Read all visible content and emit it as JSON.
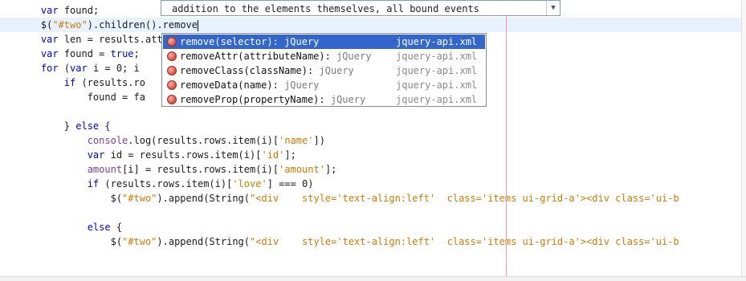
{
  "editor": {
    "lines": [
      {
        "segments": [
          {
            "t": "    "
          },
          {
            "t": "var",
            "k": "kw"
          },
          {
            "t": " found;"
          }
        ]
      },
      {
        "current": true,
        "segments": [
          {
            "t": "    $("
          },
          {
            "t": "\"#two\"",
            "k": "str"
          },
          {
            "t": ").children().remove"
          }
        ]
      },
      {
        "segments": [
          {
            "t": "    "
          },
          {
            "t": "var",
            "k": "kw"
          },
          {
            "t": " len = results.attr"
          }
        ]
      },
      {
        "segments": [
          {
            "t": "    "
          },
          {
            "t": "var",
            "k": "kw"
          },
          {
            "t": " found = "
          },
          {
            "t": "true",
            "k": "kw"
          },
          {
            "t": ";"
          }
        ]
      },
      {
        "segments": [
          {
            "t": "    "
          },
          {
            "t": "for",
            "k": "kw"
          },
          {
            "t": " ("
          },
          {
            "t": "var",
            "k": "kw"
          },
          {
            "t": " i = 0; i"
          }
        ]
      },
      {
        "segments": [
          {
            "t": "        "
          },
          {
            "t": "if",
            "k": "kw"
          },
          {
            "t": " (results.ro"
          }
        ]
      },
      {
        "segments": [
          {
            "t": "            found = fa"
          }
        ]
      },
      {
        "segments": [
          {
            "t": ""
          }
        ]
      },
      {
        "segments": [
          {
            "t": "        } "
          },
          {
            "t": "else",
            "k": "kw"
          },
          {
            "t": " {"
          }
        ]
      },
      {
        "segments": [
          {
            "t": "            "
          },
          {
            "t": "console",
            "k": "fn"
          },
          {
            "t": ".log(results.rows.item(i)["
          },
          {
            "t": "'name'",
            "k": "str"
          },
          {
            "t": "])"
          }
        ]
      },
      {
        "segments": [
          {
            "t": "            "
          },
          {
            "t": "var",
            "k": "kw"
          },
          {
            "t": " id = results.rows.item(i)["
          },
          {
            "t": "'id'",
            "k": "str"
          },
          {
            "t": "];"
          }
        ]
      },
      {
        "segments": [
          {
            "t": "            "
          },
          {
            "t": "amount",
            "k": "fn"
          },
          {
            "t": "[i] = results.rows.item(i)["
          },
          {
            "t": "'amount'",
            "k": "str"
          },
          {
            "t": "];"
          }
        ]
      },
      {
        "segments": [
          {
            "t": "            "
          },
          {
            "t": "if",
            "k": "kw"
          },
          {
            "t": " (results.rows.item(i)["
          },
          {
            "t": "'love'",
            "k": "str"
          },
          {
            "t": "] === 0)"
          }
        ]
      },
      {
        "segments": [
          {
            "t": "                $("
          },
          {
            "t": "\"#two\"",
            "k": "str"
          },
          {
            "t": ").append(String("
          },
          {
            "t": "\"<div    style='text-align:left'  class='items ui-grid-a'><div class='ui-b",
            "k": "str"
          }
        ]
      },
      {
        "segments": [
          {
            "t": ""
          }
        ]
      },
      {
        "segments": [
          {
            "t": "            "
          },
          {
            "t": "else",
            "k": "kw"
          },
          {
            "t": " {"
          }
        ]
      },
      {
        "segments": [
          {
            "t": "                $("
          },
          {
            "t": "\"#two\"",
            "k": "str"
          },
          {
            "t": ").append(String("
          },
          {
            "t": "\"<div    style='text-align:left'  class='items ui-grid-a'><div class='ui-b",
            "k": "str"
          }
        ]
      }
    ]
  },
  "doc_popup": {
    "text": "addition to the elements themselves, all bound events",
    "arrow_icon": "chevron-down"
  },
  "completion": {
    "items": [
      {
        "name": "remove",
        "params": "(selector)",
        "sep": ": ",
        "type": "jQuery",
        "source": "jquery-api.xml",
        "selected": true
      },
      {
        "name": "removeAttr",
        "params": "(attributeName)",
        "sep": ": ",
        "type": "jQuery",
        "source": "jquery-api.xml"
      },
      {
        "name": "removeClass",
        "params": "(className)",
        "sep": ": ",
        "type": "jQuery",
        "source": "jquery-api.xml"
      },
      {
        "name": "removeData",
        "params": "(name)",
        "sep": ": ",
        "type": "jQuery",
        "source": "jquery-api.xml"
      },
      {
        "name": "removeProp",
        "params": "(propertyName)",
        "sep": ": ",
        "type": "jQuery",
        "source": "jquery-api.xml"
      }
    ]
  },
  "colors": {
    "keyword": "#0000e6",
    "string": "#ce7b00",
    "selection": "#3366cc",
    "current_line": "#e8f2fe",
    "margin_line": "#f19a9a"
  }
}
